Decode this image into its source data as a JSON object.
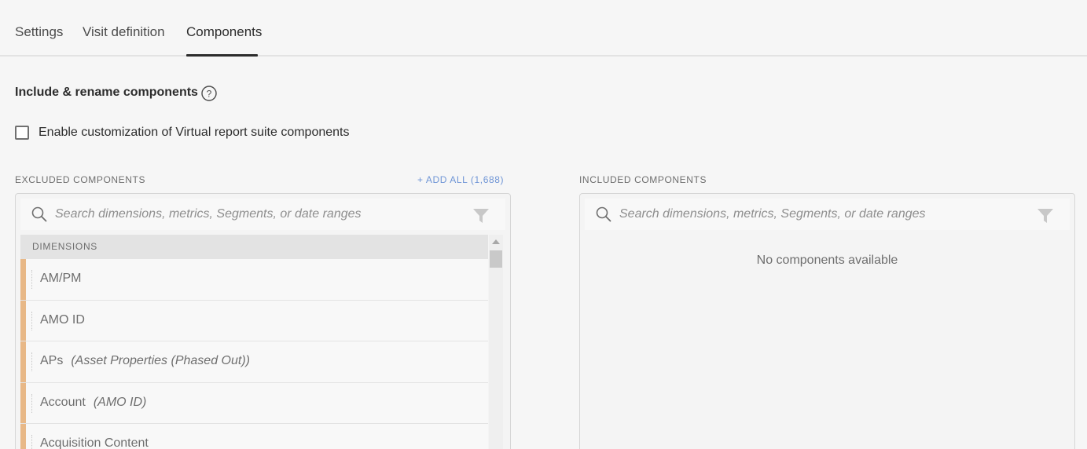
{
  "tabs": [
    {
      "label": "Settings"
    },
    {
      "label": "Visit definition"
    },
    {
      "label": "Components"
    }
  ],
  "section": {
    "title": "Include & rename components",
    "help_icon": "help-circle-icon"
  },
  "customize": {
    "label": "Enable customization of Virtual report suite components",
    "checked": false
  },
  "excluded": {
    "label": "EXCLUDED COMPONENTS",
    "add_all": "+ ADD ALL (1,688)",
    "search_placeholder": "Search dimensions, metrics, Segments, or date ranges",
    "group_header": "DIMENSIONS",
    "items": [
      {
        "name": "AM/PM",
        "sub": ""
      },
      {
        "name": "AMO ID",
        "sub": ""
      },
      {
        "name": "APs",
        "sub": "(Asset Properties (Phased Out))"
      },
      {
        "name": "Account",
        "sub": "(AMO ID)"
      },
      {
        "name": "Acquisition Content",
        "sub": ""
      }
    ],
    "accent_color": "#e8b887"
  },
  "included": {
    "label": "INCLUDED COMPONENTS",
    "search_placeholder": "Search dimensions, metrics, Segments, or date ranges",
    "empty_message": "No components available"
  },
  "colors": {
    "link": "#6f95d6",
    "active_tab_underline": "#2c2c2c"
  }
}
